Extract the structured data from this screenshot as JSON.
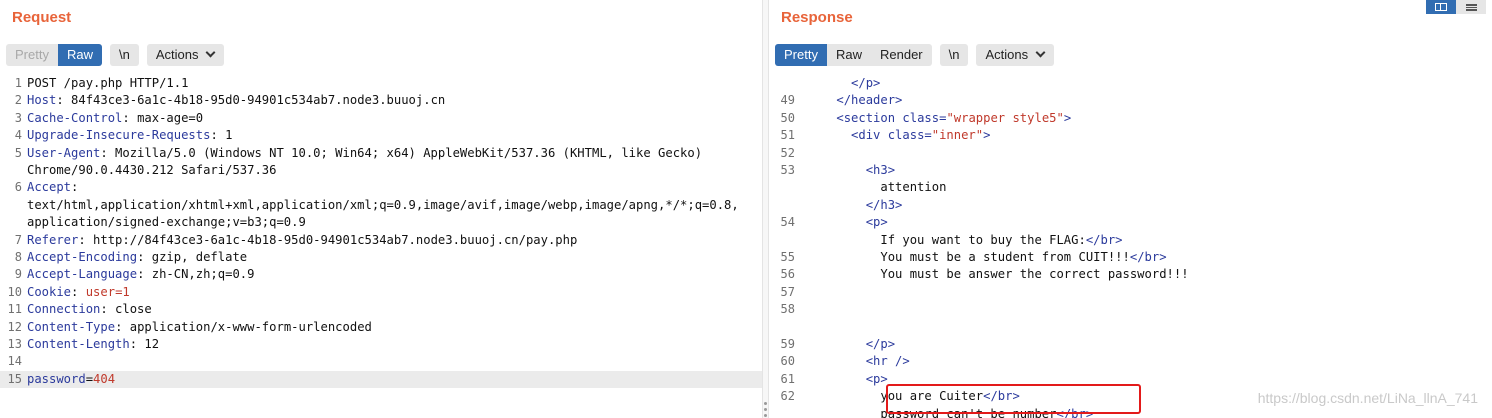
{
  "request": {
    "title": "Request",
    "tabs": [
      {
        "label": "Pretty"
      },
      {
        "label": "Raw"
      }
    ],
    "newline_label": "\\n",
    "actions_label": "Actions",
    "lines": [
      {
        "no": "1",
        "name": "",
        "value": "POST /pay.php HTTP/1.1"
      },
      {
        "no": "2",
        "name": "Host",
        "value": ": 84f43ce3-6a1c-4b18-95d0-94901c534ab7.node3.buuoj.cn"
      },
      {
        "no": "3",
        "name": "Cache-Control",
        "value": ": max-age=0"
      },
      {
        "no": "4",
        "name": "Upgrade-Insecure-Requests",
        "value": ": 1"
      },
      {
        "no": "5",
        "name": "User-Agent",
        "value": ": Mozilla/5.0 (Windows NT 10.0; Win64; x64) AppleWebKit/537.36 (KHTML, like Gecko)"
      },
      {
        "no": "",
        "name": "",
        "value": "Chrome/90.0.4430.212 Safari/537.36"
      },
      {
        "no": "6",
        "name": "Accept",
        "value": ":"
      },
      {
        "no": "",
        "name": "",
        "value": "text/html,application/xhtml+xml,application/xml;q=0.9,image/avif,image/webp,image/apng,*/*;q=0.8,"
      },
      {
        "no": "",
        "name": "",
        "value": "application/signed-exchange;v=b3;q=0.9"
      },
      {
        "no": "7",
        "name": "Referer",
        "value": ": http://84f43ce3-6a1c-4b18-95d0-94901c534ab7.node3.buuoj.cn/pay.php"
      },
      {
        "no": "8",
        "name": "Accept-Encoding",
        "value": ": gzip, deflate"
      },
      {
        "no": "9",
        "name": "Accept-Language",
        "value": ": zh-CN,zh;q=0.9"
      },
      {
        "no": "10",
        "name": "Cookie",
        "value": ": ",
        "value_red": "user=1"
      },
      {
        "no": "11",
        "name": "Connection",
        "value": ": close"
      },
      {
        "no": "12",
        "name": "Content-Type",
        "value": ": application/x-www-form-urlencoded"
      },
      {
        "no": "13",
        "name": "Content-Length",
        "value": ": 12"
      },
      {
        "no": "14",
        "name": "",
        "value": ""
      },
      {
        "no": "15",
        "name": "password",
        "value": "=",
        "value_red": "404"
      }
    ]
  },
  "response": {
    "title": "Response",
    "tabs": [
      {
        "label": "Pretty"
      },
      {
        "label": "Raw"
      },
      {
        "label": "Render"
      }
    ],
    "newline_label": "\\n",
    "actions_label": "Actions",
    "lines": [
      {
        "no": "",
        "indent": "      ",
        "a": "</p>"
      },
      {
        "no": "49",
        "indent": "    ",
        "a": "</header>"
      },
      {
        "no": "50",
        "indent": "    ",
        "a": "<section ",
        "b": "class=",
        "c": "\"wrapper style5\"",
        "d": ">"
      },
      {
        "no": "51",
        "indent": "      ",
        "a": "<div ",
        "b": "class=",
        "c": "\"inner\"",
        "d": ">"
      },
      {
        "no": "52",
        "indent": "",
        "a": ""
      },
      {
        "no": "53",
        "indent": "        ",
        "a": "<h3>"
      },
      {
        "no": "",
        "indent": "          ",
        "t": "attention"
      },
      {
        "no": "",
        "indent": "        ",
        "a": "</h3>"
      },
      {
        "no": "54",
        "indent": "        ",
        "a": "<p>"
      },
      {
        "no": "",
        "indent": "          ",
        "t": "If you want to buy the FLAG:",
        "a2": "</br>"
      },
      {
        "no": "55",
        "indent": "          ",
        "t": "You must be a student from CUIT!!!",
        "a2": "</br>"
      },
      {
        "no": "56",
        "indent": "          ",
        "t": "You must be answer the correct password!!!"
      },
      {
        "no": "57",
        "indent": "",
        "a": ""
      },
      {
        "no": "58",
        "indent": "",
        "a": ""
      },
      {
        "no": "",
        "indent": "",
        "a": ""
      },
      {
        "no": "59",
        "indent": "        ",
        "a": "</p>"
      },
      {
        "no": "60",
        "indent": "        ",
        "a": "<hr />"
      },
      {
        "no": "61",
        "indent": "        ",
        "a": "<p>"
      },
      {
        "no": "62",
        "indent": "          ",
        "t": "you are Cuiter",
        "a2": "</br>"
      },
      {
        "no": "",
        "indent": "          ",
        "t": "password can't be number",
        "a2": "</br>"
      }
    ]
  },
  "watermark": "https://blog.csdn.net/LiNa_llnA_741",
  "colors": {
    "accent": "#e8643a",
    "active_tab": "#316db2",
    "highlight_box": "#e31a1a"
  }
}
